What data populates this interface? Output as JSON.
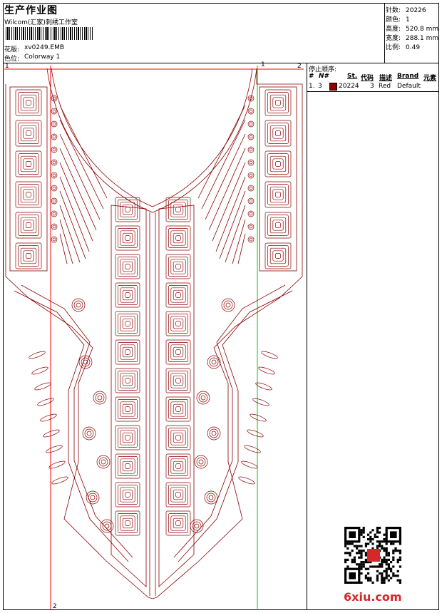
{
  "header": {
    "title": "生产作业图",
    "company": "Wilcom(汇家)刺绣工作室",
    "design_label": "花版:",
    "design_value": "xv0249.EMB",
    "colorway_label": "色位:",
    "colorway_value": "Colorway 1"
  },
  "stats": [
    {
      "label": "针数:",
      "value": "20226"
    },
    {
      "label": "颜色:",
      "value": "1"
    },
    {
      "label": "高度:",
      "value": "520.8 mm"
    },
    {
      "label": "宽度:",
      "value": "288.1 mm"
    },
    {
      "label": "比例:",
      "value": "0.49"
    }
  ],
  "stop_sequence": {
    "label": "停止顺序:",
    "columns": [
      "#",
      "N#",
      "St.",
      "代码",
      "描述",
      "Brand",
      "元素"
    ],
    "rows": [
      {
        "index": "1.",
        "needle": "3",
        "stitches": "20224",
        "code": "3",
        "description": "Red",
        "brand": "Default",
        "swatch": "#8b0000"
      }
    ]
  },
  "markers": {
    "top_left": "1",
    "top_right": "2",
    "top_mid": "1",
    "bottom": "2"
  },
  "watermark": "6xiu.com",
  "colors": {
    "thread": "#8b0000",
    "guide_red": "#ff0000",
    "guide_green": "#00cc00"
  }
}
